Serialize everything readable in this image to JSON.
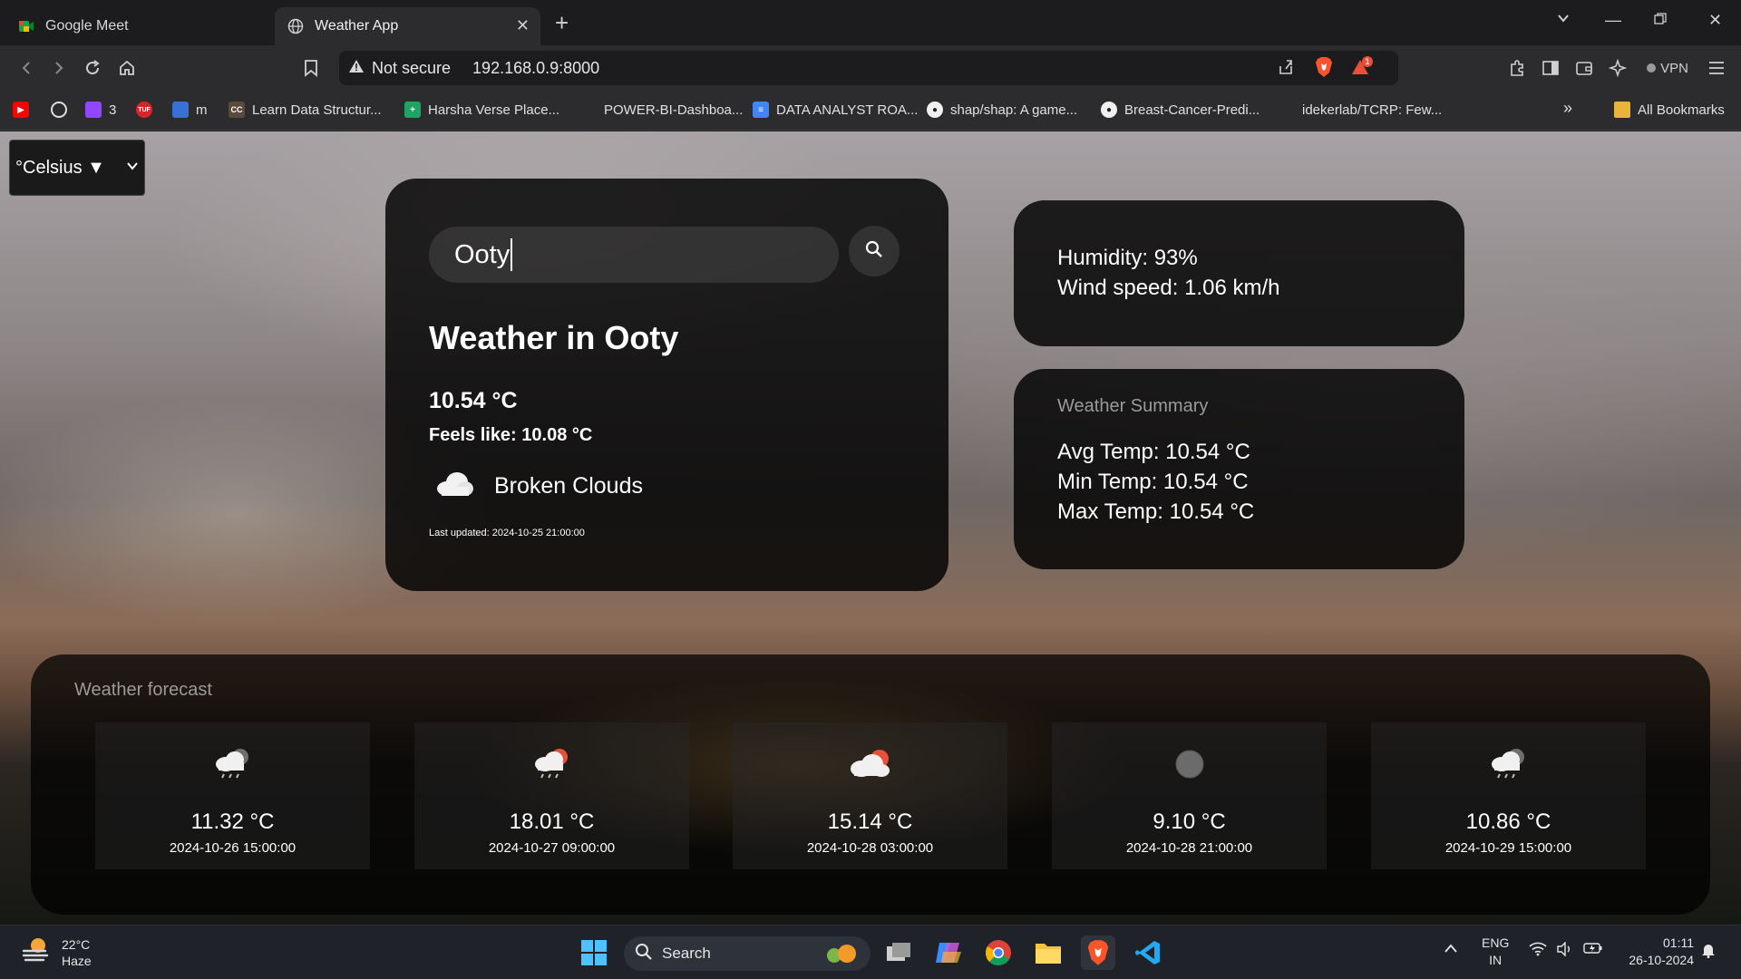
{
  "browser": {
    "tabs": [
      {
        "title": "Google Meet",
        "active": false
      },
      {
        "title": "Weather App",
        "active": true
      }
    ],
    "address": {
      "security_label": "Not secure",
      "url": "192.168.0.9:8000"
    },
    "vpn_label": "VPN",
    "shield_badge": "1",
    "bookmarks": [
      {
        "label": "3"
      },
      {
        "label": "m"
      },
      {
        "label": "Learn Data Structur..."
      },
      {
        "label": "Harsha Verse Place..."
      },
      {
        "label": "POWER-BI-Dashboa..."
      },
      {
        "label": "DATA ANALYST ROA..."
      },
      {
        "label": "shap/shap: A game..."
      },
      {
        "label": "Breast-Cancer-Predi..."
      },
      {
        "label": "idekerlab/TCRP: Few..."
      }
    ],
    "all_bookmarks": "All Bookmarks",
    "overflow": "»"
  },
  "app": {
    "unit_select": {
      "value": "°Celsius ▼"
    },
    "search": {
      "value": "Ooty"
    },
    "weather": {
      "title": "Weather in Ooty",
      "temp": "10.54 °C",
      "feels_like": "Feels like: 10.08 °C",
      "description": "Broken Clouds",
      "last_updated": "Last updated: 2024-10-25 21:00:00",
      "icon": "cloud-icon"
    },
    "details": {
      "humidity": "Humidity: 93%",
      "wind": "Wind speed: 1.06 km/h"
    },
    "summary": {
      "title": "Weather Summary",
      "avg": "Avg Temp: 10.54 °C",
      "min": "Min Temp: 10.54 °C",
      "max": "Max Temp: 10.54 °C"
    },
    "forecast": {
      "title": "Weather forecast",
      "items": [
        {
          "temp": "11.32 °C",
          "date": "2024-10-26 15:00:00",
          "icon": "night-rain-cloud-icon"
        },
        {
          "temp": "18.01 °C",
          "date": "2024-10-27 09:00:00",
          "icon": "sun-rain-cloud-icon"
        },
        {
          "temp": "15.14 °C",
          "date": "2024-10-28 03:00:00",
          "icon": "sun-cloud-icon"
        },
        {
          "temp": "9.10 °C",
          "date": "2024-10-28 21:00:00",
          "icon": "moon-icon"
        },
        {
          "temp": "10.86 °C",
          "date": "2024-10-29 15:00:00",
          "icon": "night-rain-cloud-icon"
        }
      ]
    }
  },
  "taskbar": {
    "weather_temp": "22°C",
    "weather_desc": "Haze",
    "search_label": "Search",
    "lang_top": "ENG",
    "lang_bottom": "IN",
    "time": "01:11",
    "date": "26-10-2024"
  },
  "colors": {
    "card_bg": "#000000",
    "accent_red": "#e8503a",
    "brave_orange": "#fb542b"
  }
}
